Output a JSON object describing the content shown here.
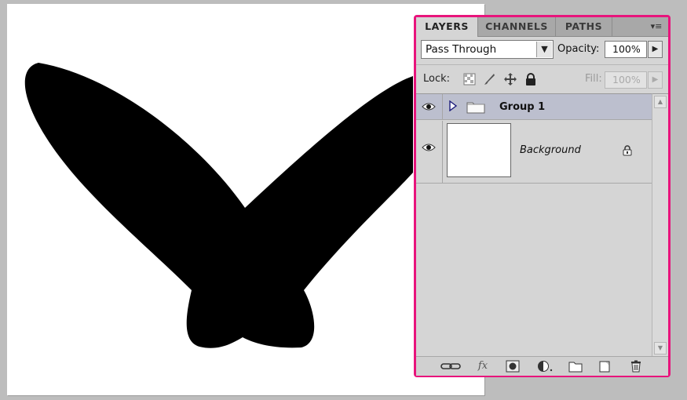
{
  "panel": {
    "tabs": [
      {
        "label": "LAYERS",
        "active": true
      },
      {
        "label": "CHANNELS",
        "active": false
      },
      {
        "label": "PATHS",
        "active": false
      }
    ],
    "blend_mode": "Pass Through",
    "opacity_label": "Opacity:",
    "opacity_value": "100%",
    "lock_label": "Lock:",
    "fill_label": "Fill:",
    "fill_value": "100%",
    "accent_color": "#e8147c"
  },
  "layers": [
    {
      "name": "Group 1",
      "type": "group",
      "visible": true,
      "selected": true
    },
    {
      "name": "Background",
      "type": "pixel",
      "visible": true,
      "locked": true,
      "selected": false
    }
  ],
  "icons": {
    "panel_menu": "panel-menu-icon",
    "lock": [
      "lock-transparent-icon",
      "lock-paint-icon",
      "lock-position-icon",
      "lock-all-icon"
    ],
    "bottom": [
      "link-layers-icon",
      "fx-icon",
      "add-mask-icon",
      "adjustment-layer-icon",
      "new-group-icon",
      "new-layer-icon",
      "trash-icon"
    ]
  },
  "bottom_bar": {
    "fx_label": "fx"
  }
}
